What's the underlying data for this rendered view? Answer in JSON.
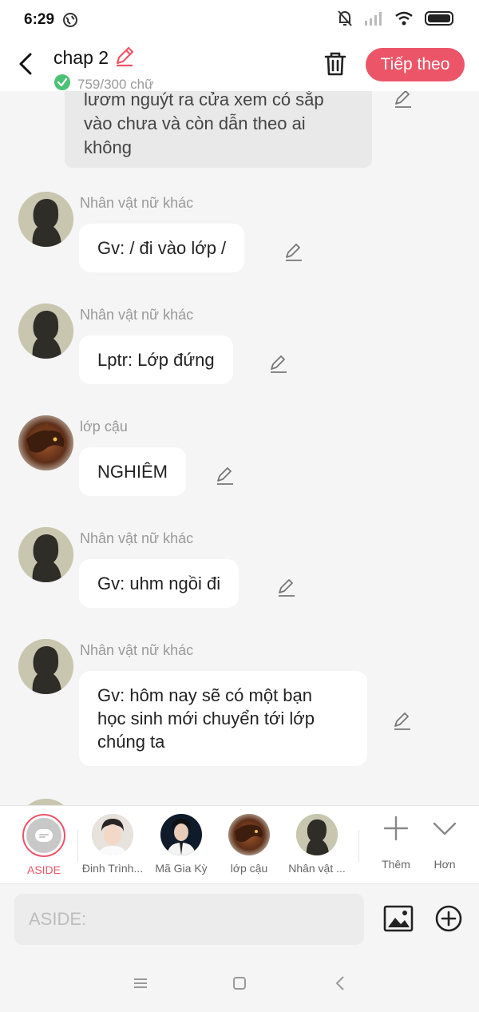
{
  "status_bar": {
    "time": "6:29"
  },
  "header": {
    "title": "chap 2",
    "word_count": "759/300 chữ",
    "next_button": "Tiếp theo"
  },
  "narration": {
    "text_line1": "lươm nguýt ra cửa xem có sắp",
    "text_line2": "vào chưa và còn dẫn theo ai",
    "text_line3": "không"
  },
  "messages": [
    {
      "speaker": "Nhân vật nữ khác",
      "text": "Gv: / đi vào lớp /"
    },
    {
      "speaker": "Nhân vật nữ khác",
      "text": "Lptr: Lớp đứng"
    },
    {
      "speaker": "lớp cậu",
      "text": "NGHIÊM"
    },
    {
      "speaker": "Nhân vật nữ khác",
      "text": "Gv: uhm ngồi đi"
    },
    {
      "speaker": "Nhân vật nữ khác",
      "text_line1": "Gv: hôm nay sẽ có một bạn",
      "text_line2": "học sinh mới chuyển tới lớp",
      "text_line3": "chúng ta"
    }
  ],
  "characters": [
    {
      "name": "ASIDE"
    },
    {
      "name": "Đinh Trình..."
    },
    {
      "name": "Mã Gia Kỳ"
    },
    {
      "name": "lớp cậu"
    },
    {
      "name": "Nhân vật ..."
    }
  ],
  "tools": {
    "add_label": "Thêm",
    "more_label": "Hơn"
  },
  "input": {
    "placeholder": "ASIDE:"
  },
  "colors": {
    "accent": "#ec5568",
    "background": "#f5f5f5",
    "bubble": "#ffffff",
    "narration_bubble": "#e9e9e9"
  }
}
